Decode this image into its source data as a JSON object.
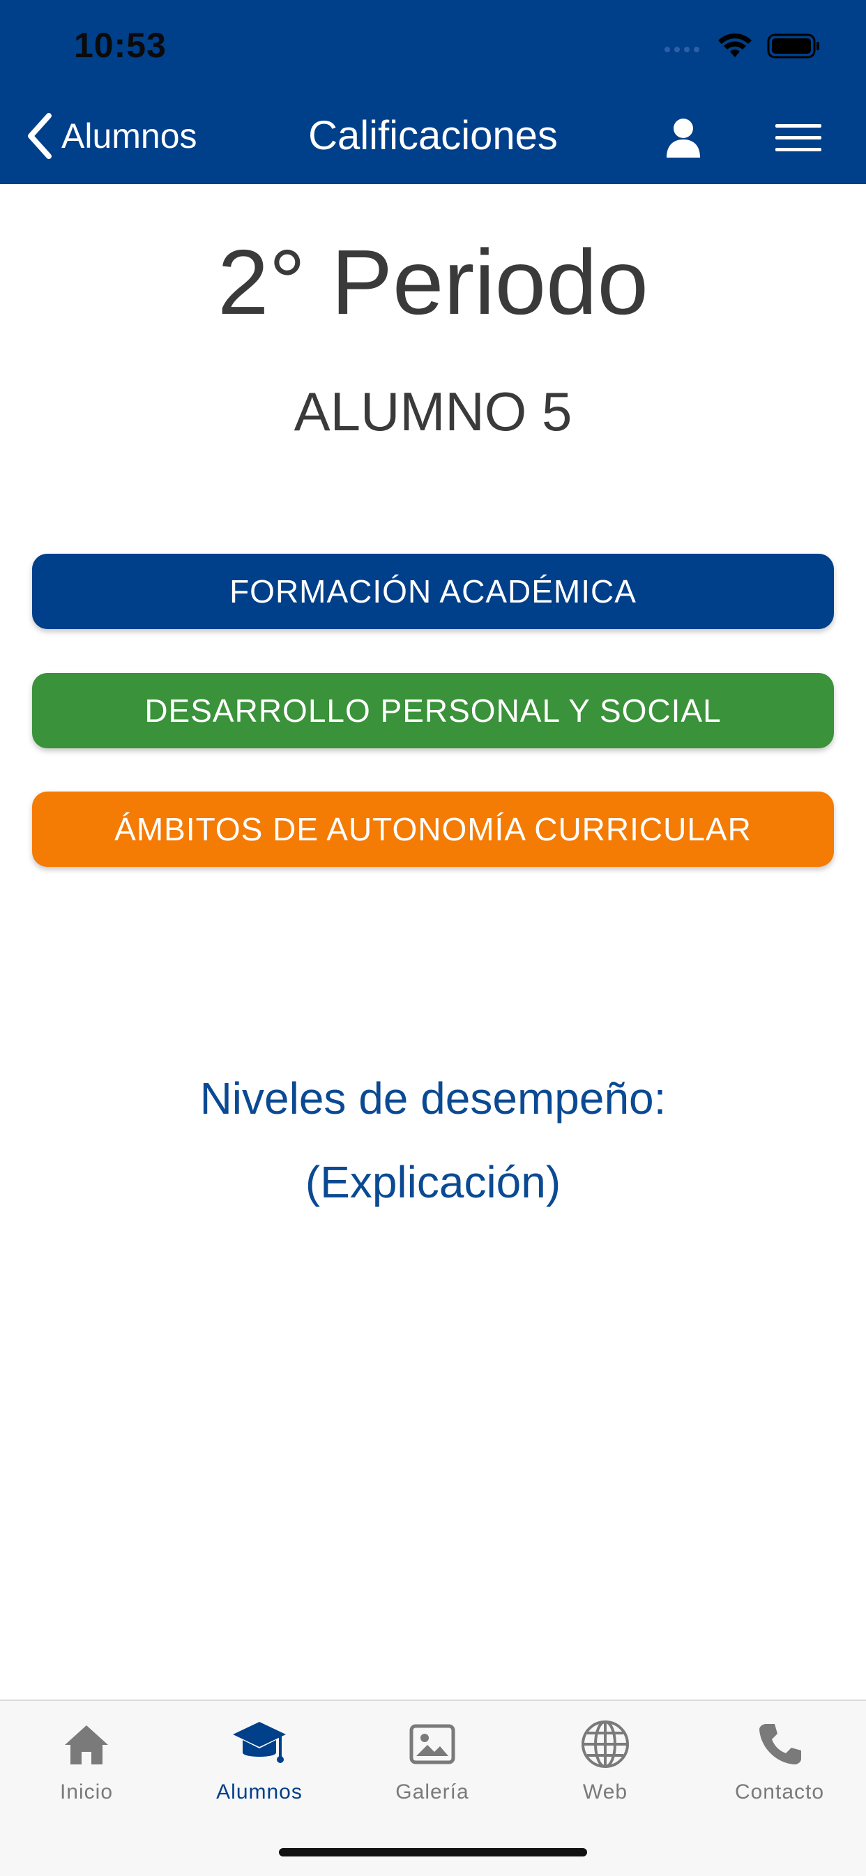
{
  "status_bar": {
    "time": "10:53"
  },
  "nav": {
    "back_label": "Alumnos",
    "title": "Calificaciones"
  },
  "content": {
    "period": "2° Periodo",
    "student": "ALUMNO 5",
    "categories": [
      {
        "label": "FORMACIÓN ACADÉMICA",
        "color": "#003F8A"
      },
      {
        "label": "DESARROLLO PERSONAL Y SOCIAL",
        "color": "#3A923A"
      },
      {
        "label": "ÁMBITOS DE AUTONOMÍA CURRICULAR",
        "color": "#F47B04"
      }
    ],
    "levels_title": "Niveles de desempeño:",
    "levels_link": "(Explicación)"
  },
  "tabbar": {
    "items": [
      {
        "label": "Inicio",
        "icon": "home-icon"
      },
      {
        "label": "Alumnos",
        "icon": "graduation-cap-icon",
        "active": true
      },
      {
        "label": "Galería",
        "icon": "image-icon"
      },
      {
        "label": "Web",
        "icon": "globe-icon"
      },
      {
        "label": "Contacto",
        "icon": "phone-icon"
      }
    ]
  },
  "colors": {
    "primary": "#003F8A",
    "text": "#3a3a3a",
    "link": "#0B4A93",
    "tab_inactive": "#7a7a7a"
  }
}
